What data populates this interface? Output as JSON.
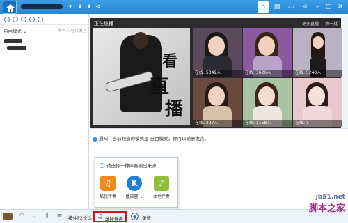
{
  "colors": {
    "topbar": "#2a86d1",
    "accent": "#2a86d1",
    "highlight_border": "#c8171e"
  },
  "left": {
    "mode_label": "自由模式 ⌄",
    "mode_hint": "所有人可以发言"
  },
  "hot": {
    "title": "正在热播",
    "more": "更多直播",
    "refresh": "换一批",
    "poster_chars": [
      "看",
      "直",
      "播"
    ],
    "thumbs": [
      {
        "label": "在线: 5349人"
      },
      {
        "label": "在线: 3626人"
      },
      {
        "label": "在线: 5240人"
      },
      {
        "label": "在线: 297人"
      },
      {
        "label": "在线: 1158人"
      },
      {
        "label": "在线: 1"
      }
    ]
  },
  "chat": {
    "notice": "通知：当前频道的模式是 自由模式，你可以随意发言。"
  },
  "popup": {
    "title": "请选择一种伴奏输出来源",
    "items": [
      {
        "label": "酷我伴奏",
        "icon": "music-note-icon",
        "glyph": "♫"
      },
      {
        "label": "播放器 ⌄",
        "icon": "k-player-icon",
        "glyph": "K"
      },
      {
        "label": "本地伴奏",
        "icon": "local-music-icon",
        "glyph": "♪"
      }
    ]
  },
  "bottom": {
    "f2_label": "按住F2说话",
    "select_label": "选择伴奏",
    "record_label": "录音"
  },
  "watermark": {
    "url": "jb51.net",
    "name": "脚本之家"
  }
}
